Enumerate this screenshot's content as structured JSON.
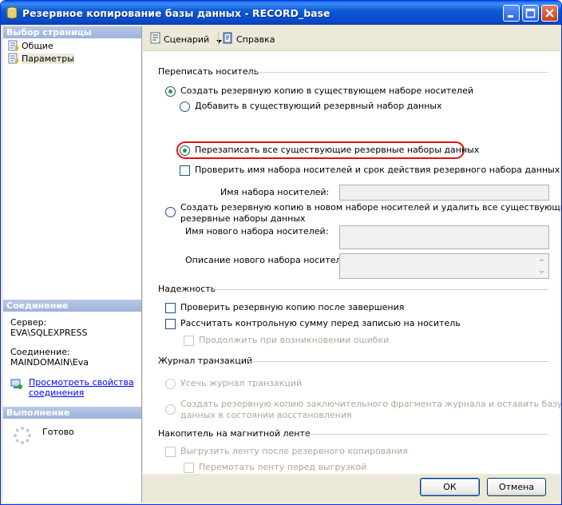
{
  "window": {
    "title": "Резервное копирование базы данных - RECORD_base"
  },
  "left": {
    "pages_header": "Выбор страницы",
    "pages": [
      {
        "label": "Общие"
      },
      {
        "label": "Параметры"
      }
    ],
    "connection_header": "Соединение",
    "server_label": "Сервер:",
    "server_value": "EVA\\SQLEXPRESS",
    "connection_label": "Соединение:",
    "connection_value": "MAINDOMAIN\\Eva",
    "view_props_line1": "Просмотреть свойства",
    "view_props_line2": "соединения",
    "progress_header": "Выполнение",
    "progress_status": "Готово"
  },
  "toolbar": {
    "script": "Сценарий",
    "help": "Справка"
  },
  "overwrite": {
    "title": "Переписать носитель",
    "existing_set": "Создать резервную копию в существующем наборе носителей",
    "append": "Добавить в существующий резервный набор данных",
    "overwrite_all": "Перезаписать все существующие резервные наборы данных",
    "check_name": "Проверить имя набора носителей и срок действия резервного набора данных",
    "media_name_label": "Имя набора носителей:",
    "new_set_line1": "Создать резервную копию в новом наборе носителей и удалить все существующие",
    "new_set_line2": "резервные наборы данных",
    "new_name_label": "Имя нового набора носителей:",
    "new_desc_label": "Описание нового набора носителей:"
  },
  "reliability": {
    "title": "Надежность",
    "verify": "Проверить резервную копию после завершения",
    "checksum": "Рассчитать контрольную сумму перед записью на носитель",
    "continue_on_error": "Продолжить при возникновении ошибки"
  },
  "log": {
    "title": "Журнал транзакций",
    "truncate": "Усечь журнал транзакций",
    "tail_line1": "Создать резервную копию заключительного фрагмента журнала и оставить базу",
    "tail_line2": "данных в состоянии восстановления"
  },
  "tape": {
    "title": "Накопитель на магнитной ленте",
    "unload": "Выгрузить ленту после резервного копирования",
    "rewind": "Перемотать ленту перед выгрузкой"
  },
  "buttons": {
    "ok": "ОК",
    "cancel": "Отмена"
  }
}
